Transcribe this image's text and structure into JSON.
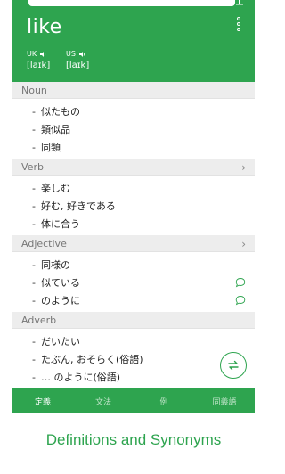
{
  "header": {
    "word": "like",
    "uk_label": "UK",
    "us_label": "US",
    "uk_ipa": "[laɪk]",
    "us_ipa": "[laɪk]"
  },
  "sections": [
    {
      "label": "Noun",
      "items": [
        "似たもの",
        "類似品",
        "同類"
      ]
    },
    {
      "label": "Verb",
      "items": [
        "楽しむ",
        "好む, 好きである",
        "体に合う"
      ]
    },
    {
      "label": "Adjective",
      "items": [
        "同様の",
        "似ている",
        "のように"
      ]
    },
    {
      "label": "Adverb",
      "items": [
        "だいたい",
        "たぶん, おそらく(俗語)",
        "… のように(俗語)"
      ]
    }
  ],
  "tabs": [
    "定義",
    "文法",
    "例",
    "同義語"
  ],
  "caption": "Definitions and Synonyms",
  "colors": {
    "accent": "#2ea44f",
    "section_bg": "#ededed"
  }
}
